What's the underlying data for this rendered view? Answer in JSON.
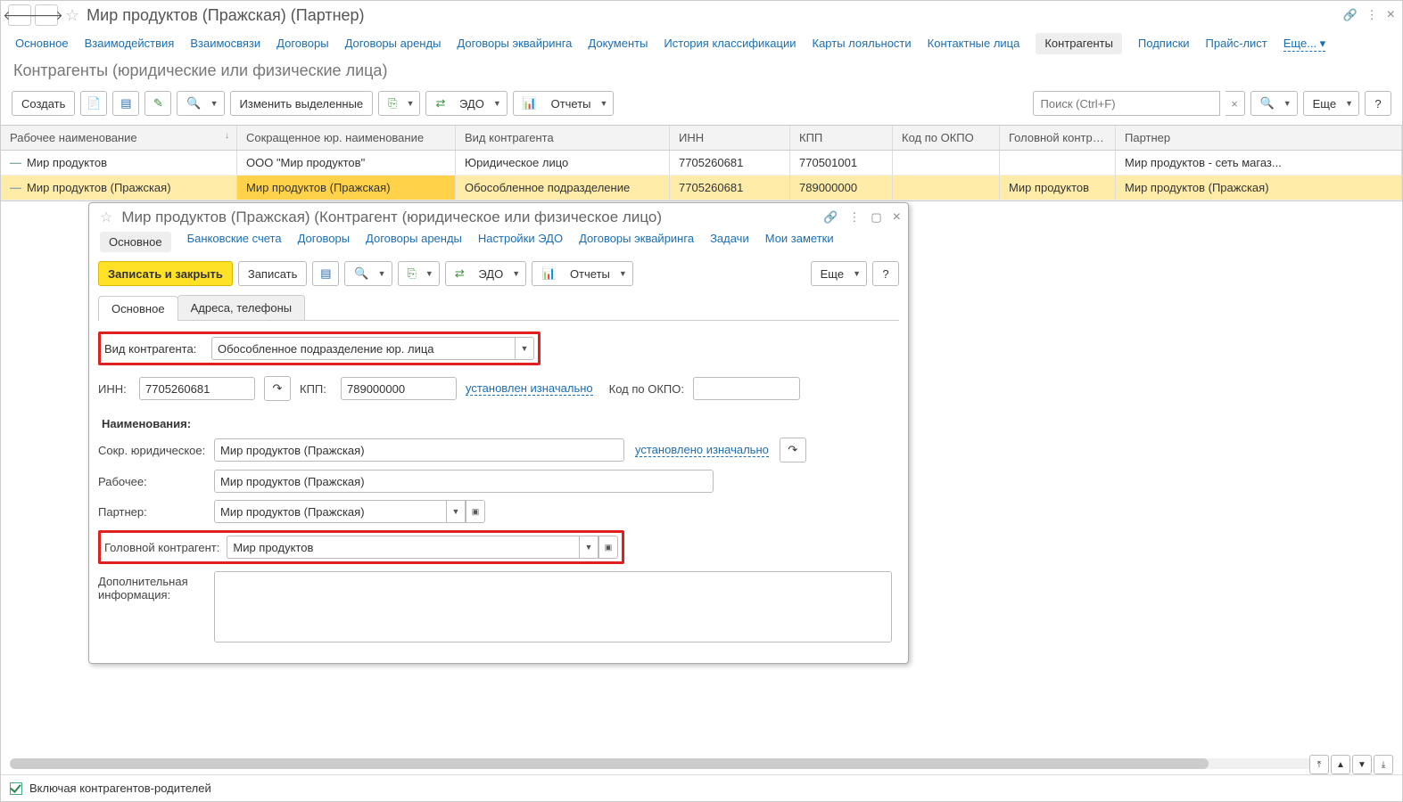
{
  "topbar": {
    "title": "Мир продуктов (Пражская) (Партнер)"
  },
  "tabs": {
    "items": [
      {
        "label": "Основное",
        "active": false
      },
      {
        "label": "Взаимодействия"
      },
      {
        "label": "Взаимосвязи"
      },
      {
        "label": "Договоры"
      },
      {
        "label": "Договоры аренды"
      },
      {
        "label": "Договоры эквайринга"
      },
      {
        "label": "Документы"
      },
      {
        "label": "История классификации"
      },
      {
        "label": "Карты лояльности"
      },
      {
        "label": "Контактные лица"
      },
      {
        "label": "Контрагенты",
        "active": true
      },
      {
        "label": "Подписки"
      },
      {
        "label": "Прайс-лист"
      },
      {
        "label": "Еще..."
      }
    ]
  },
  "section_title": "Контрагенты (юридические или физические лица)",
  "toolbar": {
    "create": "Создать",
    "edit_selected": "Изменить выделенные",
    "edo": "ЭДО",
    "reports": "Отчеты",
    "search_placeholder": "Поиск (Ctrl+F)",
    "more": "Еще"
  },
  "table": {
    "headers": [
      "Рабочее наименование",
      "Сокращенное юр. наименование",
      "Вид контрагента",
      "ИНН",
      "КПП",
      "Код по ОКПО",
      "Головной контрагент",
      "Партнер"
    ],
    "rows": [
      {
        "name": "Мир продуктов",
        "short": "ООО \"Мир продуктов\"",
        "kind": "Юридическое лицо",
        "inn": "7705260681",
        "kpp": "770501001",
        "okpo": "",
        "head": "",
        "partner": "Мир продуктов - сеть магаз...",
        "selected": false
      },
      {
        "name": "Мир продуктов (Пражская)",
        "short": "Мир продуктов (Пражская)",
        "kind": "Обособленное подразделение",
        "inn": "7705260681",
        "kpp": "789000000",
        "okpo": "",
        "head": "Мир продуктов",
        "partner": "Мир продуктов (Пражская)",
        "selected": true
      }
    ]
  },
  "dialog": {
    "title": "Мир продуктов (Пражская) (Контрагент (юридическое или физическое лицо)",
    "tabs": [
      "Основное",
      "Банковские счета",
      "Договоры",
      "Договоры аренды",
      "Настройки ЭДО",
      "Договоры эквайринга",
      "Задачи",
      "Мои заметки"
    ],
    "active_tab": "Основное",
    "toolbar": {
      "save_close": "Записать и закрыть",
      "save": "Записать",
      "edo": "ЭДО",
      "reports": "Отчеты",
      "more": "Еще"
    },
    "inner_tabs": [
      "Основное",
      "Адреса, телефоны"
    ],
    "fields": {
      "kind_label": "Вид контрагента:",
      "kind_value": "Обособленное подразделение юр. лица",
      "inn_label": "ИНН:",
      "inn_value": "7705260681",
      "kpp_label": "КПП:",
      "kpp_value": "789000000",
      "kpp_link": "установлен изначально",
      "okpo_label": "Код по ОКПО:",
      "okpo_value": "",
      "naming_header": "Наименования:",
      "short_label": "Сокр. юридическое:",
      "short_value": "Мир продуктов (Пражская)",
      "short_link": "установлено изначально",
      "work_label": "Рабочее:",
      "work_value": "Мир продуктов (Пражская)",
      "partner_label": "Партнер:",
      "partner_value": "Мир продуктов (Пражская)",
      "head_label": "Головной контрагент:",
      "head_value": "Мир продуктов",
      "extra_label": "Дополнительная информация:",
      "extra_value": ""
    }
  },
  "statusbar": {
    "label": "Включая контрагентов-родителей",
    "checked": true
  }
}
